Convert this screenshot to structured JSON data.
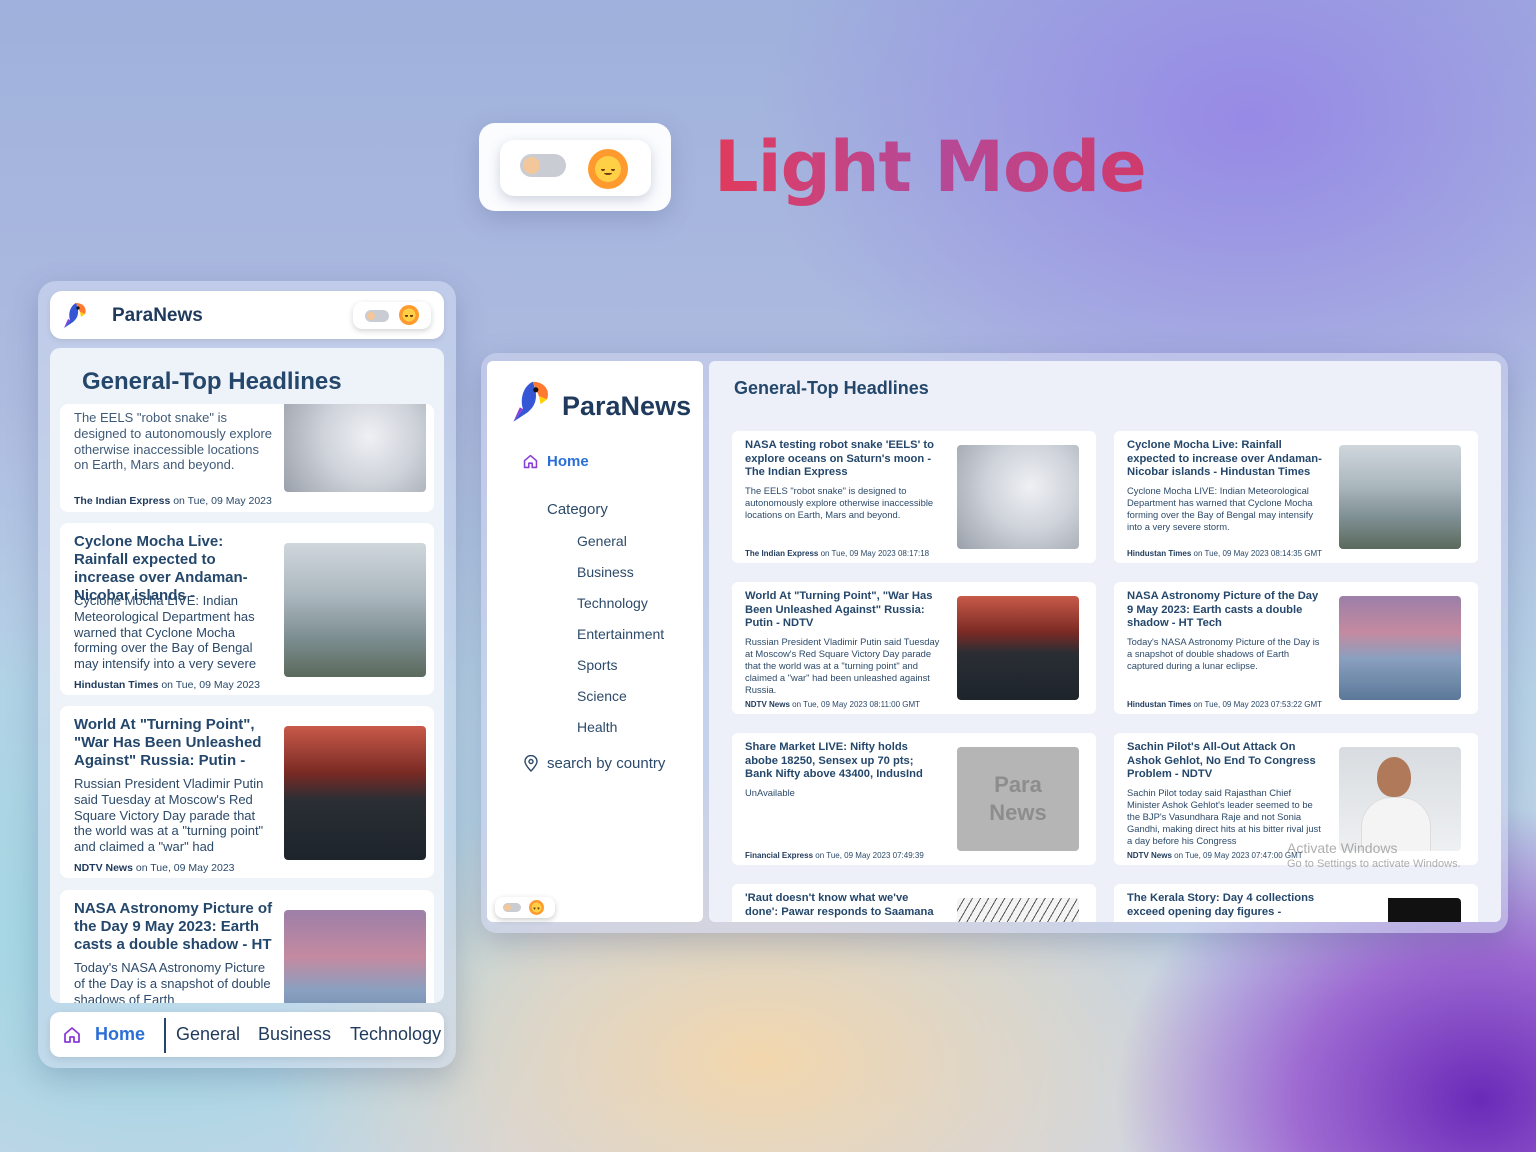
{
  "hero": {
    "title": "Light Mode"
  },
  "brand": "ParaNews",
  "mobile": {
    "heading": "General-Top Headlines",
    "cards": [
      {
        "title": "",
        "desc": "The EELS \"robot snake\" is designed to autonomously explore otherwise inaccessible locations on Earth, Mars and beyond.",
        "source": "The Indian Express",
        "date": " on Tue, 09 May 2023"
      },
      {
        "title": "Cyclone Mocha Live: Rainfall expected to increase over Andaman-Nicobar islands -",
        "desc": "Cyclone Mocha LIVE: Indian Meteorological Department has warned that Cyclone Mocha forming over the Bay of Bengal may intensify into a very severe",
        "source": "Hindustan Times",
        "date": " on Tue, 09 May 2023"
      },
      {
        "title": "World At \"Turning Point\", \"War Has Been Unleashed Against\" Russia: Putin -",
        "desc": "Russian President Vladimir Putin said Tuesday at Moscow's Red Square Victory Day parade that the world was at a \"turning point\" and claimed a \"war\" had",
        "source": "NDTV News",
        "date": " on Tue, 09 May 2023"
      },
      {
        "title": "NASA Astronomy Picture of the Day 9 May 2023: Earth casts a double shadow - HT",
        "desc": "Today's NASA Astronomy Picture of the Day is a snapshot of double shadows of Earth",
        "source": "",
        "date": ""
      }
    ],
    "nav": {
      "home": "Home",
      "items": [
        "General",
        "Business",
        "Technology"
      ]
    }
  },
  "desktop": {
    "sidebar": {
      "home": "Home",
      "category": "Category",
      "items": [
        "General",
        "Business",
        "Technology",
        "Entertainment",
        "Sports",
        "Science",
        "Health"
      ],
      "search": "search by country"
    },
    "heading": "General-Top Headlines",
    "cards": [
      {
        "title": "NASA testing robot snake 'EELS' to explore oceans on Saturn's moon - The Indian Express",
        "desc": "The EELS \"robot snake\" is designed to autonomously explore otherwise inaccessible locations on Earth, Mars and beyond.",
        "source": "The Indian Express",
        "date": " on Tue, 09 May 2023 08:17:18"
      },
      {
        "title": "Cyclone Mocha Live: Rainfall expected to increase over Andaman-Nicobar islands - Hindustan Times",
        "desc": "Cyclone Mocha LIVE: Indian Meteorological Department has warned that Cyclone Mocha forming over the Bay of Bengal may intensify into a very severe storm.",
        "source": "Hindustan Times",
        "date": " on Tue, 09 May 2023 08:14:35 GMT"
      },
      {
        "title": "World At \"Turning Point\", \"War Has Been Unleashed Against\" Russia: Putin - NDTV",
        "desc": "Russian President Vladimir Putin said Tuesday at Moscow's Red Square Victory Day parade that the world was at a \"turning point\" and claimed a \"war\" had been unleashed against Russia.",
        "source": "NDTV News",
        "date": " on Tue, 09 May 2023 08:11:00 GMT"
      },
      {
        "title": "NASA Astronomy Picture of the Day 9 May 2023: Earth casts a double shadow - HT Tech",
        "desc": "Today's NASA Astronomy Picture of the Day is a snapshot of double shadows of Earth captured during a lunar eclipse.",
        "source": "Hindustan Times",
        "date": " on Tue, 09 May 2023 07:53:22 GMT"
      },
      {
        "title": "Share Market LIVE: Nifty holds abobe 18250, Sensex up 70 pts; Bank Nifty above 43400, IndusInd",
        "desc": "UnAvailable",
        "source": "Financial Express",
        "date": " on Tue, 09 May 2023 07:49:39",
        "placeholder": "Para News"
      },
      {
        "title": "Sachin Pilot's All-Out Attack On Ashok Gehlot, No End To Congress Problem - NDTV",
        "desc": "Sachin Pilot today said Rajasthan Chief Minister Ashok Gehlot's leader seemed to be the BJP's Vasundhara Raje and not Sonia Gandhi, making direct hits at his bitter rival just a day before his Congress",
        "source": "NDTV News",
        "date": " on Tue, 09 May 2023 07:47:00 GMT"
      },
      {
        "title": "'Raut doesn't know what we've done': Pawar responds to Saamana",
        "desc": "",
        "source": "",
        "date": ""
      },
      {
        "title": "The Kerala Story: Day 4 collections exceed opening day figures -",
        "desc": "",
        "source": "",
        "date": ""
      }
    ]
  },
  "watermark": {
    "line1": "Activate Windows",
    "line2": "Go to Settings to activate Windows."
  }
}
